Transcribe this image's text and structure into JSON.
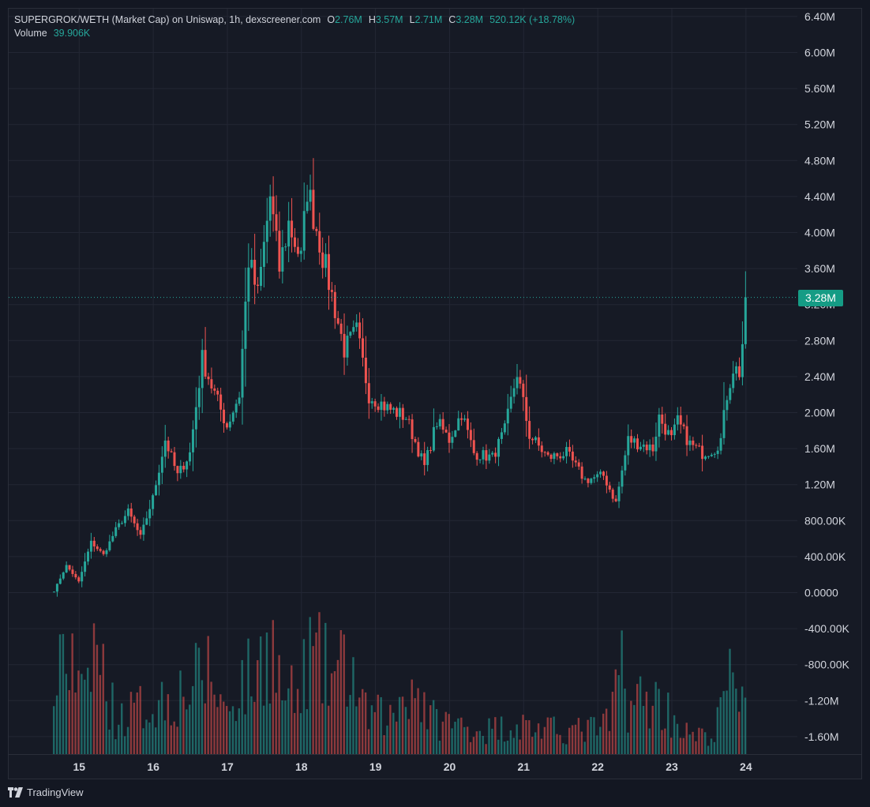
{
  "legend": {
    "symbol": "SUPERGROK/WETH (Market Cap) on Uniswap, 1h, dexscreener.com",
    "open_label": "O",
    "open": "2.76M",
    "high_label": "H",
    "high": "3.57M",
    "low_label": "L",
    "low": "2.71M",
    "close_label": "C",
    "close": "3.28M",
    "change": "520.12K (+18.78%)",
    "volume_label": "Volume",
    "volume": "39.906K"
  },
  "last_price_badge": "3.28M",
  "brand": "TradingView",
  "colors": {
    "up": "#26a69a",
    "down": "#ef5350",
    "background": "#131722",
    "grid": "#232734",
    "badge": "#159c85"
  },
  "chart_data": {
    "type": "candlestick",
    "title": "SUPERGROK/WETH (Market Cap) on Uniswap, 1h, dexscreener.com",
    "y_axis_ticks": [
      "6.40M",
      "6.00M",
      "5.60M",
      "5.20M",
      "4.80M",
      "4.40M",
      "4.00M",
      "3.60M",
      "3.20M",
      "2.80M",
      "2.40M",
      "2.00M",
      "1.60M",
      "1.20M",
      "800.00K",
      "400.00K",
      "0.0000",
      "-400.00K",
      "-800.00K",
      "-1.20M",
      "-1.60M"
    ],
    "y_tick_values": [
      6400000,
      6000000,
      5600000,
      5200000,
      4800000,
      4400000,
      4000000,
      3600000,
      3200000,
      2800000,
      2400000,
      2000000,
      1600000,
      1200000,
      800000,
      400000,
      0,
      -400000,
      -800000,
      -1200000,
      -1600000
    ],
    "ylim": [
      -1800000,
      6600000
    ],
    "x_axis_ticks": [
      "15",
      "16",
      "17",
      "18",
      "19",
      "20",
      "21",
      "22",
      "23",
      "24"
    ],
    "x_tick_hours": [
      8,
      32,
      56,
      80,
      104,
      128,
      152,
      176,
      200,
      224
    ],
    "last_price": 3280000,
    "grid": true,
    "interval": "1h",
    "anchors": [
      {
        "h": 0,
        "v": 20000
      },
      {
        "h": 4,
        "v": 300000
      },
      {
        "h": 8,
        "v": 120000
      },
      {
        "h": 12,
        "v": 560000
      },
      {
        "h": 16,
        "v": 420000
      },
      {
        "h": 20,
        "v": 700000
      },
      {
        "h": 24,
        "v": 900000
      },
      {
        "h": 28,
        "v": 620000
      },
      {
        "h": 32,
        "v": 1050000
      },
      {
        "h": 36,
        "v": 1700000
      },
      {
        "h": 40,
        "v": 1300000
      },
      {
        "h": 44,
        "v": 1550000
      },
      {
        "h": 48,
        "v": 2600000
      },
      {
        "h": 51,
        "v": 2300000
      },
      {
        "h": 56,
        "v": 1850000
      },
      {
        "h": 60,
        "v": 2200000
      },
      {
        "h": 63,
        "v": 3700000
      },
      {
        "h": 66,
        "v": 3300000
      },
      {
        "h": 70,
        "v": 4400000
      },
      {
        "h": 73,
        "v": 3600000
      },
      {
        "h": 76,
        "v": 4100000
      },
      {
        "h": 80,
        "v": 3700000
      },
      {
        "h": 82,
        "v": 4500000
      },
      {
        "h": 86,
        "v": 3900000
      },
      {
        "h": 90,
        "v": 3300000
      },
      {
        "h": 94,
        "v": 2700000
      },
      {
        "h": 98,
        "v": 2900000
      },
      {
        "h": 102,
        "v": 2200000
      },
      {
        "h": 108,
        "v": 2050000
      },
      {
        "h": 114,
        "v": 1950000
      },
      {
        "h": 120,
        "v": 1400000
      },
      {
        "h": 124,
        "v": 1900000
      },
      {
        "h": 128,
        "v": 1700000
      },
      {
        "h": 132,
        "v": 2000000
      },
      {
        "h": 136,
        "v": 1550000
      },
      {
        "h": 142,
        "v": 1500000
      },
      {
        "h": 146,
        "v": 1800000
      },
      {
        "h": 150,
        "v": 2450000
      },
      {
        "h": 154,
        "v": 1750000
      },
      {
        "h": 160,
        "v": 1500000
      },
      {
        "h": 166,
        "v": 1550000
      },
      {
        "h": 172,
        "v": 1250000
      },
      {
        "h": 178,
        "v": 1300000
      },
      {
        "h": 182,
        "v": 1000000
      },
      {
        "h": 186,
        "v": 1700000
      },
      {
        "h": 190,
        "v": 1650000
      },
      {
        "h": 194,
        "v": 1600000
      },
      {
        "h": 196,
        "v": 1950000
      },
      {
        "h": 200,
        "v": 1700000
      },
      {
        "h": 202,
        "v": 1900000
      },
      {
        "h": 206,
        "v": 1650000
      },
      {
        "h": 210,
        "v": 1550000
      },
      {
        "h": 214,
        "v": 1600000
      },
      {
        "h": 216,
        "v": 1700000
      },
      {
        "h": 218,
        "v": 2200000
      },
      {
        "h": 220,
        "v": 2500000
      },
      {
        "h": 222,
        "v": 2450000
      },
      {
        "h": 223,
        "v": 2760000
      },
      {
        "h": 224,
        "v": 3280000
      }
    ],
    "volume_profile": [
      {
        "h": 0,
        "v": 0.45
      },
      {
        "h": 1,
        "v": 0.85
      },
      {
        "h": 3,
        "v": 0.95
      },
      {
        "h": 10,
        "v": 0.4
      },
      {
        "h": 13,
        "v": 0.95
      },
      {
        "h": 20,
        "v": 0.3
      },
      {
        "h": 34,
        "v": 0.45
      },
      {
        "h": 44,
        "v": 0.55
      },
      {
        "h": 50,
        "v": 0.7
      },
      {
        "h": 56,
        "v": 0.35
      },
      {
        "h": 60,
        "v": 0.6
      },
      {
        "h": 66,
        "v": 0.65
      },
      {
        "h": 68,
        "v": 0.9
      },
      {
        "h": 70,
        "v": 1.0
      },
      {
        "h": 74,
        "v": 0.5
      },
      {
        "h": 80,
        "v": 0.45
      },
      {
        "h": 82,
        "v": 0.85
      },
      {
        "h": 90,
        "v": 0.65
      },
      {
        "h": 96,
        "v": 0.75
      },
      {
        "h": 100,
        "v": 0.35
      },
      {
        "h": 110,
        "v": 0.3
      },
      {
        "h": 114,
        "v": 0.6
      },
      {
        "h": 118,
        "v": 0.55
      },
      {
        "h": 122,
        "v": 0.3
      },
      {
        "h": 130,
        "v": 0.25
      },
      {
        "h": 140,
        "v": 0.2
      },
      {
        "h": 150,
        "v": 0.25
      },
      {
        "h": 160,
        "v": 0.2
      },
      {
        "h": 172,
        "v": 0.2
      },
      {
        "h": 180,
        "v": 0.25
      },
      {
        "h": 184,
        "v": 0.8
      },
      {
        "h": 186,
        "v": 0.45
      },
      {
        "h": 196,
        "v": 0.45
      },
      {
        "h": 206,
        "v": 0.15
      },
      {
        "h": 214,
        "v": 0.15
      },
      {
        "h": 218,
        "v": 0.6
      },
      {
        "h": 222,
        "v": 0.55
      },
      {
        "h": 224,
        "v": 0.65
      }
    ]
  }
}
